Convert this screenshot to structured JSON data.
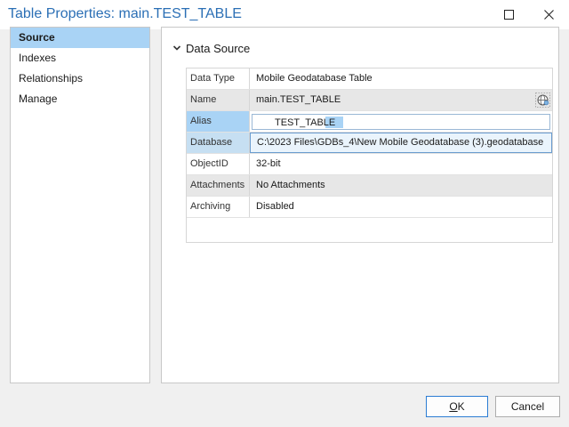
{
  "window": {
    "title": "Table Properties: main.TEST_TABLE",
    "maximize_icon": "maximize-icon",
    "close_icon": "close-icon"
  },
  "sidebar": {
    "items": [
      {
        "label": "Source",
        "active": true
      },
      {
        "label": "Indexes",
        "active": false
      },
      {
        "label": "Relationships",
        "active": false
      },
      {
        "label": "Manage",
        "active": false
      }
    ]
  },
  "section": {
    "title": "Data Source",
    "expanded": true,
    "caret_icon": "chevron-down-icon"
  },
  "properties": {
    "data_type": {
      "label": "Data Type",
      "value": "Mobile Geodatabase Table"
    },
    "name": {
      "label": "Name",
      "value": "main.TEST_TABLE",
      "icon": "globe-icon"
    },
    "alias": {
      "label": "Alias",
      "value": "TEST_TABLE"
    },
    "database": {
      "label": "Database",
      "value": "C:\\2023 Files\\GDBs_4\\New Mobile Geodatabase (3).geodatabase"
    },
    "objectid": {
      "label": "ObjectID",
      "value": "32-bit"
    },
    "attachments": {
      "label": "Attachments",
      "value": "No Attachments"
    },
    "archiving": {
      "label": "Archiving",
      "value": "Disabled"
    }
  },
  "buttons": {
    "ok": {
      "mnemonic": "O",
      "rest": "K"
    },
    "cancel": {
      "label": "Cancel"
    }
  },
  "colors": {
    "title": "#2b6fb5",
    "selection": "#a9d3f5",
    "focus_border": "#2b7cd3"
  }
}
